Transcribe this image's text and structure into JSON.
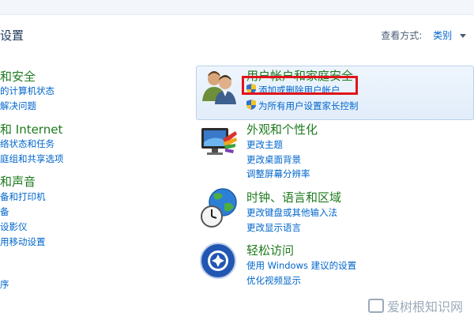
{
  "header": {
    "title": "设置",
    "view_by_label": "查看方式:",
    "view_by_value": "类别"
  },
  "left_categories": [
    {
      "title": "和安全",
      "links": [
        "的计算机状态",
        "解决问题"
      ]
    },
    {
      "title": "和 Internet",
      "links": [
        "络状态和任务",
        "庭组和共享选项"
      ]
    },
    {
      "title": "和声音",
      "links": [
        "备和打印机",
        "备",
        "设影仪",
        "用移动设置"
      ]
    },
    {
      "title": "",
      "links": [
        "序"
      ]
    }
  ],
  "right_categories": [
    {
      "title": "用户帐户和家庭安全",
      "icon": "users-icon",
      "links": [
        "添加或删除用户帐户",
        "为所有用户设置家长控制"
      ]
    },
    {
      "title": "外观和个性化",
      "icon": "display-palette-icon",
      "links": [
        "更改主题",
        "更改桌面背景",
        "调整屏幕分辨率"
      ]
    },
    {
      "title": "时钟、语言和区域",
      "icon": "globe-clock-icon",
      "links": [
        "更改键盘或其他输入法",
        "更改显示语言"
      ]
    },
    {
      "title": "轻松访问",
      "icon": "ease-of-access-icon",
      "links": [
        "使用 Windows 建议的设置",
        "优化视频显示"
      ]
    }
  ],
  "watermark": "爱树根知识网",
  "colors": {
    "category_title": "#1e7a1e",
    "link": "#0066cc",
    "highlight_border": "#e0141c"
  }
}
